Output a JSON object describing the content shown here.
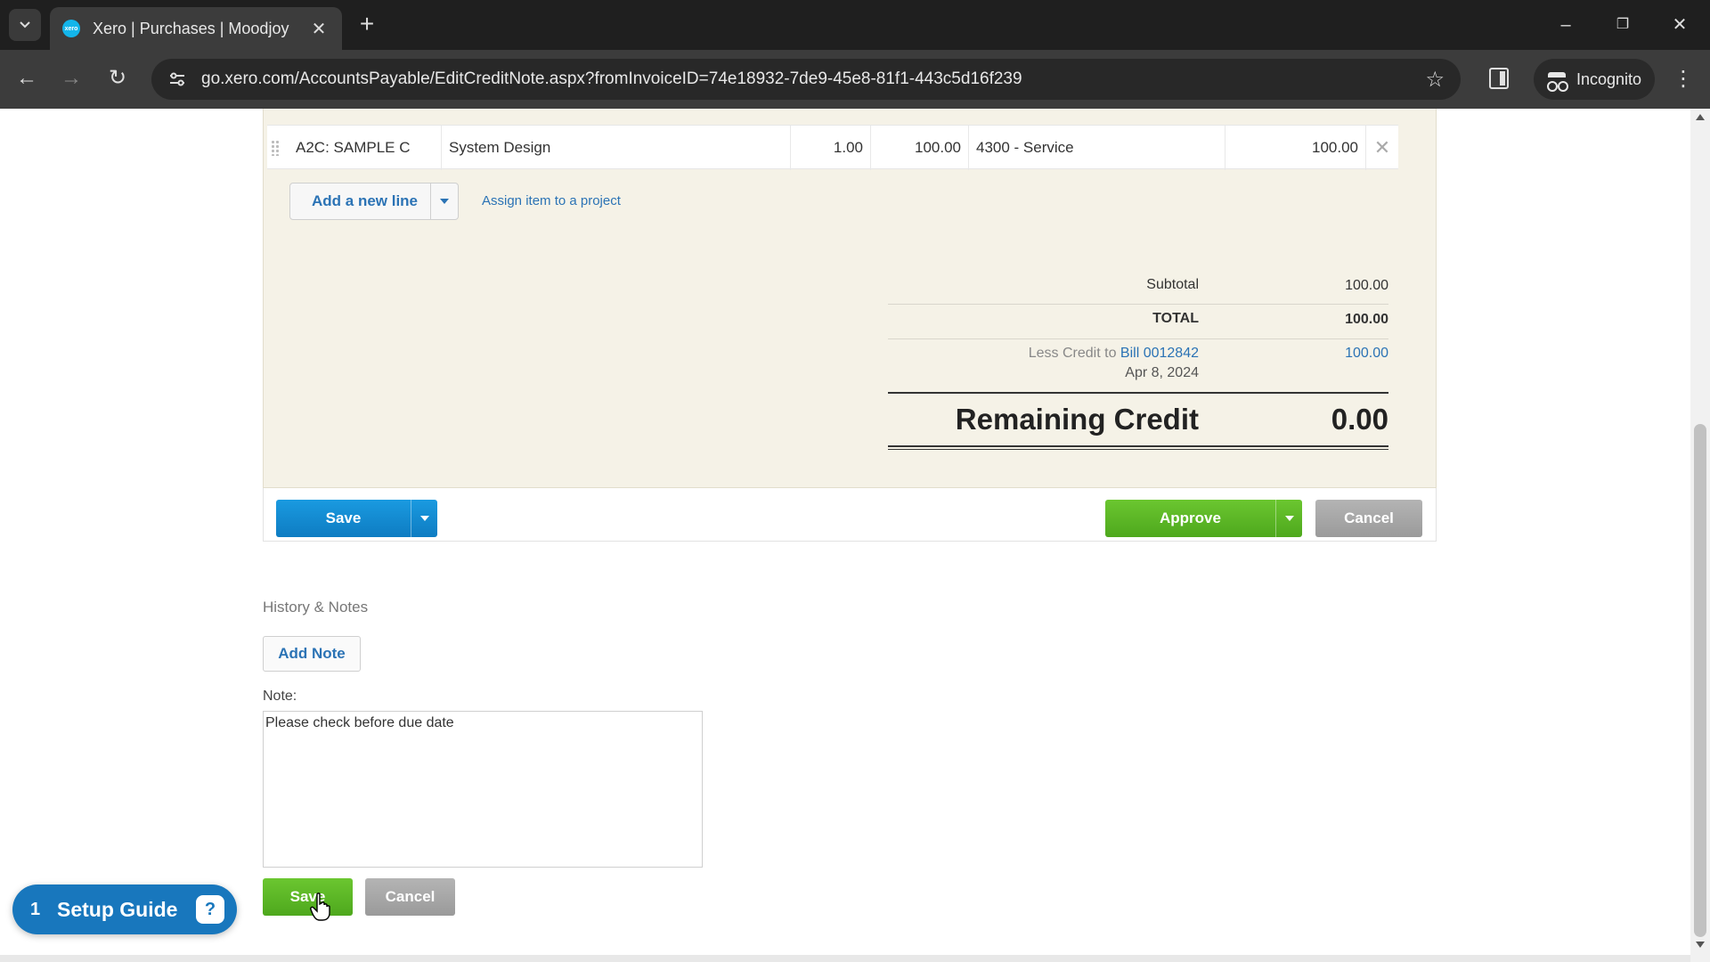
{
  "browser": {
    "tab_title": "Xero | Purchases | Moodjoy",
    "favicon_text": "xero",
    "url": "go.xero.com/AccountsPayable/EditCreditNote.aspx?fromInvoiceID=74e18932-7de9-45e8-81f1-443c5d16f239",
    "incognito_label": "Incognito"
  },
  "line_item": {
    "item": "A2C: SAMPLE C",
    "description": "System Design",
    "quantity": "1.00",
    "unit_price": "100.00",
    "account": "4300 - Service",
    "amount": "100.00"
  },
  "line_actions": {
    "add_line_label": "Add a new line",
    "assign_project_label": "Assign item to a project"
  },
  "totals": {
    "subtotal_label": "Subtotal",
    "subtotal_value": "100.00",
    "total_label": "TOTAL",
    "total_value": "100.00",
    "less_credit_prefix": "Less Credit to",
    "less_credit_bill": "Bill 0012842",
    "less_credit_date": "Apr 8, 2024",
    "less_credit_value": "100.00",
    "remaining_label": "Remaining Credit",
    "remaining_value": "0.00"
  },
  "actions": {
    "save_label": "Save",
    "approve_label": "Approve",
    "cancel_label": "Cancel"
  },
  "history": {
    "title": "History & Notes",
    "add_note_label": "Add Note",
    "note_label": "Note:",
    "note_value": "Please check before due date",
    "save_label": "Save",
    "cancel_label": "Cancel"
  },
  "setup_guide": {
    "count": "1",
    "label": "Setup Guide",
    "icon_glyph": "?"
  },
  "colors": {
    "primary_blue": "#0e7cc2",
    "approve_green": "#4ea81d",
    "link_blue": "#2b73b5",
    "panel_bg": "#f5f2e7"
  }
}
